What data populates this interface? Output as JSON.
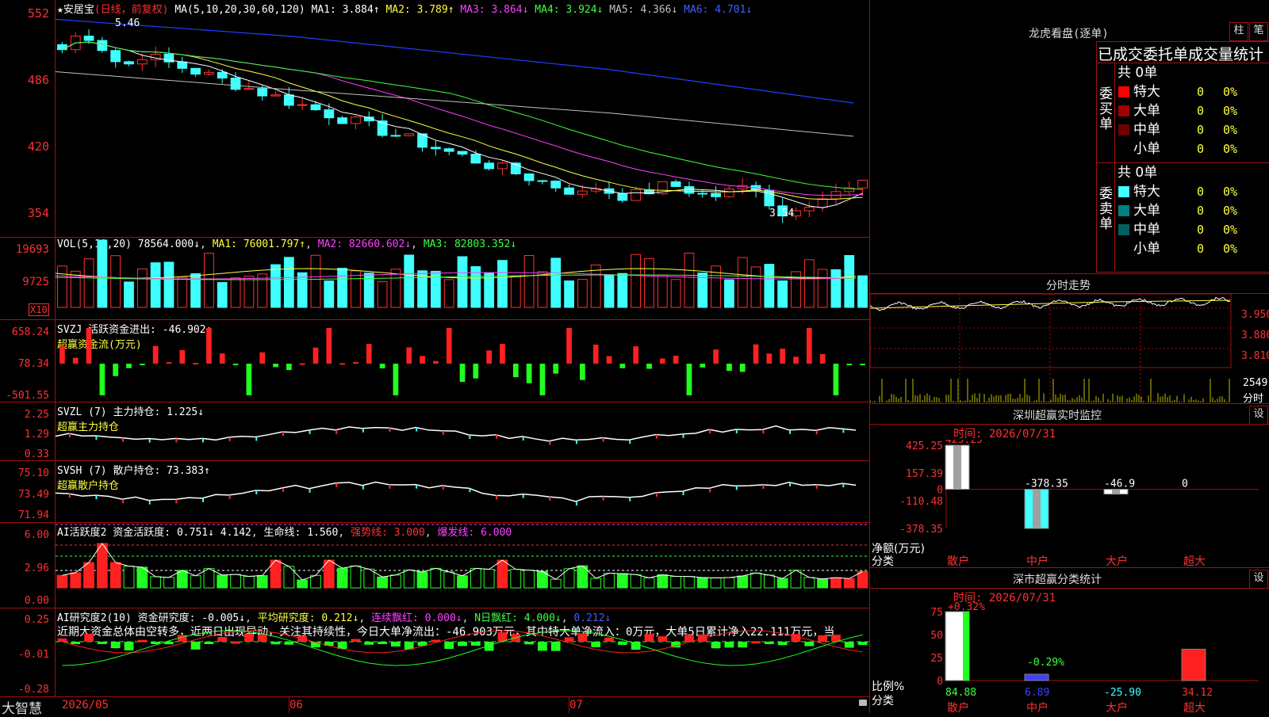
{
  "app": {
    "name": "大智慧"
  },
  "main_chart": {
    "stock": "★安居宝",
    "period": "(日线，前复权)",
    "ma_label": "MA(5,10,20,30,60,120)",
    "ma": [
      {
        "label": "MA1:",
        "value": "3.884",
        "arrow": "↑",
        "color": "#ffffff"
      },
      {
        "label": "MA2:",
        "value": "3.789",
        "arrow": "↑",
        "color": "#ffff40"
      },
      {
        "label": "MA3:",
        "value": "3.864",
        "arrow": "↓",
        "color": "#ff40ff"
      },
      {
        "label": "MA4:",
        "value": "3.924",
        "arrow": "↓",
        "color": "#40ff40"
      },
      {
        "label": "MA5:",
        "value": "4.366",
        "arrow": "↓",
        "color": "#c0c0c0"
      },
      {
        "label": "MA6:",
        "value": "4.701",
        "arrow": "↓",
        "color": "#4060ff"
      }
    ],
    "y_ticks": [
      "552",
      "486",
      "420",
      "354"
    ],
    "high_mark": "5.46",
    "low_mark": "3.54"
  },
  "vol_panel": {
    "label": "VOL(5,10,20)",
    "value": "78564.000↓",
    "ma1": "MA1: 76001.797↑",
    "ma2": "MA2: 82660.602↓",
    "ma3": "MA3: 82803.352↓",
    "y_ticks": [
      "19693",
      "9725"
    ],
    "unit": "X10"
  },
  "svzj_panel": {
    "label": "SVZJ  活跃资金进出: -46.902↑",
    "sub": "超赢资金流(万元)",
    "y_ticks": [
      "658.24",
      "78.34",
      "-501.55"
    ]
  },
  "svzl_panel": {
    "label": "SVZL (7) 主力持仓: 1.225↓",
    "sub": "超赢主力持仓",
    "y_ticks": [
      "2.25",
      "1.29",
      "0.33"
    ]
  },
  "svsh_panel": {
    "label": "SVSH (7) 散户持仓: 73.383↑",
    "sub": "超赢散户持仓",
    "y_ticks": [
      "75.10",
      "73.49",
      "71.94"
    ]
  },
  "ai_active_panel": {
    "label": "AI活跃度2 资金活跃度: 0.751↓ 4.142",
    "life": "生命线: 1.560",
    "strong": "强势线: 3.000",
    "burst": "爆发线: 6.000",
    "y_ticks": [
      "6.00",
      "2.96",
      "0.00"
    ]
  },
  "ai_research_panel": {
    "label": "AI研究度2(10) 资金研究度: -0.005↓",
    "avg": "平均研究度: 0.212↓",
    "cont": "连续飘红: 0.000↓",
    "nday": "N日飘红: 4.000↓",
    "last": "0.212↓",
    "note": "近期大资金总体由空转多，近两日出现异动，关注其持续性，今日大单净流出：-46.903万元，其中特大单净流入：0万元，大单5日累计净入22.111万元，当",
    "y_ticks": [
      "0.25",
      "-0.01",
      "-0.28"
    ]
  },
  "x_axis": {
    "labels": [
      "2026/05",
      "06",
      "07"
    ]
  },
  "dragon_tiger": {
    "title": "龙虎看盘(逐单)",
    "btn_bar": "柱",
    "btn_pen": "笔",
    "header": "已成交委托单成交量统计",
    "buy_side": "委买单",
    "sell_side": "委卖单",
    "buy_total": "共 0单",
    "sell_total": "共 0单",
    "buy_rows": [
      {
        "name": "特大",
        "count": "0",
        "pct": "0%",
        "color": "#ff0000"
      },
      {
        "name": "大单",
        "count": "0",
        "pct": "0%",
        "color": "#a00000"
      },
      {
        "name": "中单",
        "count": "0",
        "pct": "0%",
        "color": "#700000"
      },
      {
        "name": "小单",
        "count": "0",
        "pct": "0%",
        "color": "#000000"
      }
    ],
    "sell_rows": [
      {
        "name": "特大",
        "count": "0",
        "pct": "0%",
        "color": "#40ffff"
      },
      {
        "name": "大单",
        "count": "0",
        "pct": "0%",
        "color": "#008080"
      },
      {
        "name": "中单",
        "count": "0",
        "pct": "0%",
        "color": "#006060"
      },
      {
        "name": "小单",
        "count": "0",
        "pct": "0%",
        "color": "#000000"
      }
    ]
  },
  "intraday": {
    "title": "分时走势",
    "prices": [
      "3.950",
      "3.880",
      "3.810"
    ],
    "vol": "2549",
    "vol_label": "分时"
  },
  "sz_monitor": {
    "title": "深圳超赢实时监控",
    "btn": "设",
    "time": "时间: 2026/07/31",
    "y_ticks": [
      "425.25",
      "157.39",
      "0",
      "-110.48",
      "-378.35"
    ],
    "ylabel": "净额(万元)",
    "xlabel": "分类",
    "categories": [
      "散户",
      "中户",
      "大户",
      "超大"
    ],
    "values_text": [
      "425.25",
      "-378.35",
      "-46.9",
      "0"
    ]
  },
  "sz_class": {
    "title": "深市超赢分类统计",
    "btn": "设",
    "time": "时间: 2026/07/31",
    "y_ticks": [
      "75",
      "50",
      "25",
      "0"
    ],
    "ylabel": "比例%",
    "xlabel": "分类",
    "categories": [
      "散户",
      "中户",
      "大户",
      "超大"
    ],
    "top_labels": [
      "+0.32%",
      "-0.29%"
    ],
    "bottom_values": [
      "84.88",
      "6.89",
      "-25.90",
      "34.12"
    ]
  },
  "chart_data": [
    {
      "type": "bar",
      "title": "深圳超赢实时监控",
      "ylabel": "净额(万元)",
      "categories": [
        "散户",
        "中户",
        "大户",
        "超大"
      ],
      "values": [
        425.25,
        -378.35,
        -46.9,
        0
      ],
      "ylim": [
        -378.35,
        425.25
      ]
    },
    {
      "type": "bar",
      "title": "深市超赢分类统计",
      "ylabel": "比例%",
      "categories": [
        "散户",
        "中户",
        "大户",
        "超大"
      ],
      "values": [
        84.88,
        6.89,
        -25.9,
        34.12
      ],
      "ylim": [
        0,
        75
      ]
    }
  ]
}
